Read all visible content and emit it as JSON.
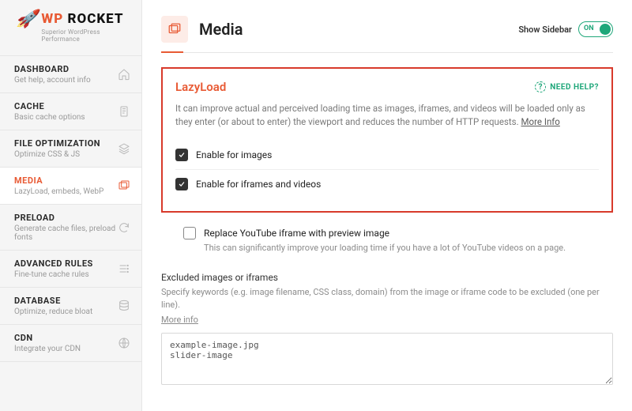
{
  "brand": {
    "name_wp": "WP",
    "name_rocket": "ROCKET",
    "tagline": "Superior WordPress Performance"
  },
  "sidebar": {
    "items": [
      {
        "title": "DASHBOARD",
        "sub": "Get help, account info",
        "icon": "home"
      },
      {
        "title": "CACHE",
        "sub": "Basic cache options",
        "icon": "doc"
      },
      {
        "title": "FILE OPTIMIZATION",
        "sub": "Optimize CSS & JS",
        "icon": "layers"
      },
      {
        "title": "MEDIA",
        "sub": "LazyLoad, embeds, WebP",
        "icon": "images",
        "active": true
      },
      {
        "title": "PRELOAD",
        "sub": "Generate cache files, preload fonts",
        "icon": "refresh"
      },
      {
        "title": "ADVANCED RULES",
        "sub": "Fine-tune cache rules",
        "icon": "sliders"
      },
      {
        "title": "DATABASE",
        "sub": "Optimize, reduce bloat",
        "icon": "database"
      },
      {
        "title": "CDN",
        "sub": "Integrate your CDN",
        "icon": "globe"
      }
    ]
  },
  "header": {
    "title": "Media",
    "show_sidebar_label": "Show Sidebar",
    "toggle_text": "ON"
  },
  "lazyload": {
    "title": "LazyLoad",
    "help_label": "NEED HELP?",
    "desc": "It can improve actual and perceived loading time as images, iframes, and videos will be loaded only as they enter (or about to enter) the viewport and reduces the number of HTTP requests.",
    "more_info": "More Info",
    "enable_images": "Enable for images",
    "enable_iframes": "Enable for iframes and videos"
  },
  "youtube": {
    "label": "Replace YouTube iframe with preview image",
    "desc": "This can significantly improve your loading time if you have a lot of YouTube videos on a page."
  },
  "excluded": {
    "title": "Excluded images or iframes",
    "desc": "Specify keywords (e.g. image filename, CSS class, domain) from the image or iframe code to be excluded (one per line).",
    "more_info": "More info",
    "value": "example-image.jpg\nslider-image"
  }
}
